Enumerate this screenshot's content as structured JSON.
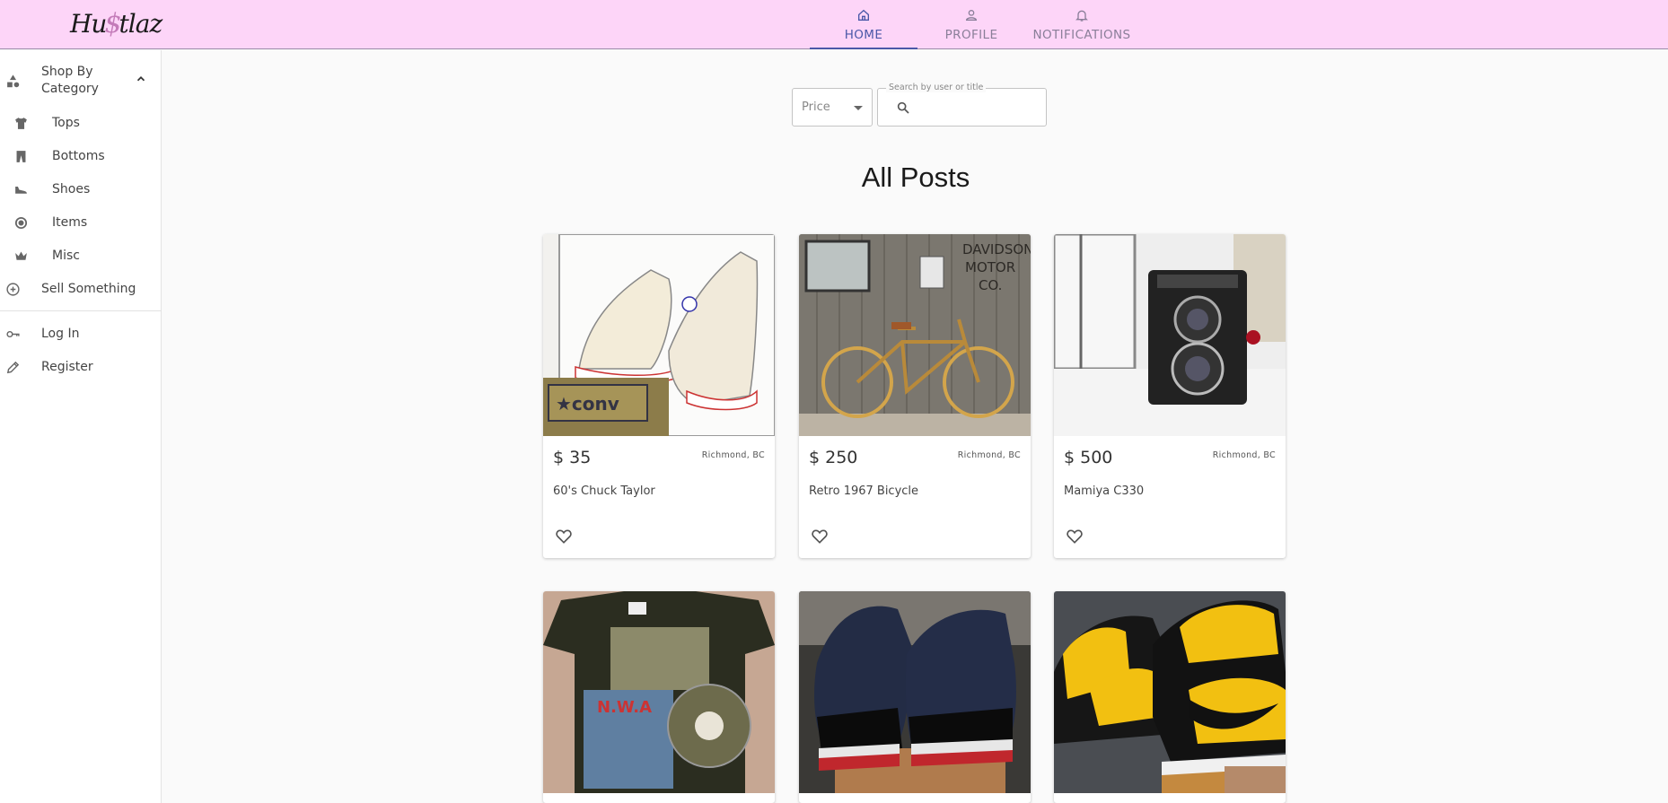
{
  "app": {
    "logo_left": "Hu",
    "logo_mid": "$",
    "logo_right": "tlaz"
  },
  "nav": {
    "items": [
      {
        "label": "HOME",
        "icon": "home-icon",
        "active": true
      },
      {
        "label": "PROFILE",
        "icon": "person-icon",
        "active": false
      },
      {
        "label": "NOTIFICATIONS",
        "icon": "bell-icon",
        "active": false
      }
    ]
  },
  "sidebar": {
    "category_header": "Shop By Category",
    "categories": [
      {
        "label": "Tops",
        "icon": "tshirt-icon"
      },
      {
        "label": "Bottoms",
        "icon": "pants-icon"
      },
      {
        "label": "Shoes",
        "icon": "shoe-icon"
      },
      {
        "label": "Items",
        "icon": "target-icon"
      },
      {
        "label": "Misc",
        "icon": "crown-icon"
      }
    ],
    "sell": "Sell Something",
    "login": "Log In",
    "register": "Register"
  },
  "filters": {
    "price_label": "Price",
    "search_label": "Search by user or title",
    "search_value": ""
  },
  "main": {
    "title": "All Posts"
  },
  "posts": [
    {
      "price": "$ 35",
      "location": "Richmond, BC",
      "title": "60's Chuck Taylor"
    },
    {
      "price": "$ 250",
      "location": "Richmond, BC",
      "title": "Retro 1967 Bicycle"
    },
    {
      "price": "$ 500",
      "location": "Richmond, BC",
      "title": "Mamiya C330"
    },
    {
      "price": "",
      "location": "",
      "title": ""
    },
    {
      "price": "",
      "location": "",
      "title": ""
    },
    {
      "price": "",
      "location": "",
      "title": ""
    }
  ],
  "colors": {
    "topbar": "#fdd5f8",
    "accent": "#4a58a8",
    "nav_inactive": "#8a7f99"
  }
}
